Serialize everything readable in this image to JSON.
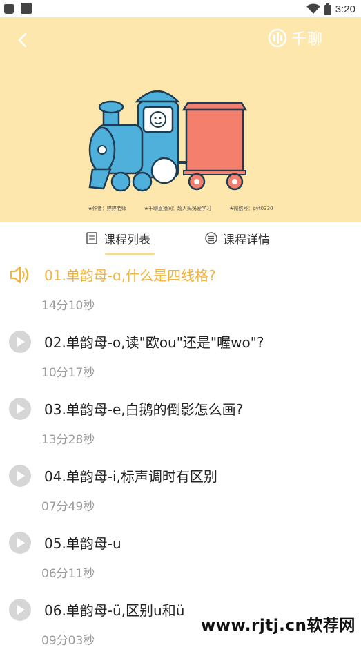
{
  "status_bar": {
    "time": "3:20"
  },
  "banner": {
    "brand": "千聊",
    "credits": [
      "★作者：婷婷老师",
      "★千聊直播间：超人妈妈爱学习",
      "★微信号：gyt0330"
    ]
  },
  "tabs": {
    "list_label": "课程列表",
    "detail_label": "课程详情"
  },
  "lessons": [
    {
      "title": "01.单韵母-ɑ,什么是四线格?",
      "duration": "14分10秒",
      "active": true
    },
    {
      "title": "02.单韵母-o,读\"欧ou\"还是\"喔wo\"?",
      "duration": "10分17秒",
      "active": false
    },
    {
      "title": "03.单韵母-e,白鹅的倒影怎么画?",
      "duration": "13分28秒",
      "active": false
    },
    {
      "title": "04.单韵母-i,标声调时有区别",
      "duration": "07分49秒",
      "active": false
    },
    {
      "title": "05.单韵母-u",
      "duration": "06分11秒",
      "active": false
    },
    {
      "title": "06.单韵母-ü,区别u和ü",
      "duration": "09分03秒",
      "active": false
    }
  ],
  "watermark": "www.rjtj.cn软荐网",
  "colors": {
    "banner_bg": "#fde7ac",
    "accent": "#f2b33a",
    "duration": "#9a9a9a"
  },
  "icons": [
    "back-icon",
    "brand-logo-icon",
    "wifi-icon",
    "battery-icon",
    "book-icon",
    "list-icon",
    "speaker-icon",
    "play-icon"
  ]
}
